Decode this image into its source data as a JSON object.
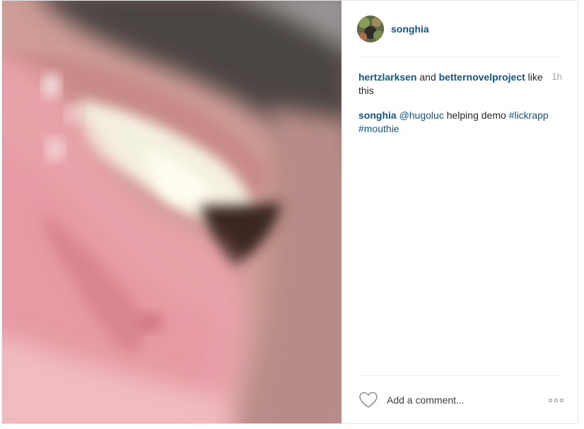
{
  "post": {
    "author": "songhia",
    "time": "1h",
    "likes": {
      "user1": "hertzlarksen",
      "conj": " and ",
      "user2": "betternovelproject",
      "suffix": " like this"
    },
    "caption": {
      "author": "songhia",
      "mention": "@hugoluc",
      "text": " helping demo ",
      "tag1": "#lickrapp",
      "tag2": "#mouthie"
    }
  },
  "comment_box": {
    "placeholder": "Add a comment..."
  },
  "icons": {
    "like": "heart-icon",
    "more": "more-options-icon"
  },
  "colors": {
    "link": "#125688",
    "muted": "#a5a7aa",
    "text": "#262626"
  }
}
